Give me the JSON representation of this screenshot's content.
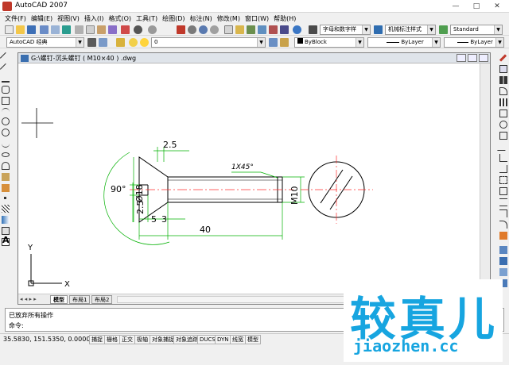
{
  "window": {
    "title": "AutoCAD 2007",
    "controls": [
      "—",
      "□",
      "✕"
    ]
  },
  "menu": [
    "文件(F)",
    "编辑(E)",
    "视图(V)",
    "插入(I)",
    "格式(O)",
    "工具(T)",
    "绘图(D)",
    "标注(N)",
    "修改(M)",
    "窗口(W)",
    "帮助(H)"
  ],
  "toolbar": {
    "text_style": "字母和数字样",
    "dim_style": "机械标注样式",
    "table_style": "Standard"
  },
  "properties": {
    "workspace": "AutoCAD 经典",
    "layer": "0",
    "color": "ByBlock",
    "linetype": "ByLayer",
    "lineweight": "ByLayer"
  },
  "document": {
    "title": "G:\\螺钉-沉头螺钉 ( M10×40 ) .dwg",
    "tabs": [
      "模型",
      "布局1",
      "布局2"
    ]
  },
  "drawing": {
    "dims": {
      "top": "2.5",
      "chamfer": "1X45°",
      "angle": "90°",
      "diameter": "Ø18",
      "slot": "2.5",
      "head_a": "5",
      "head_b": "3",
      "length": "40",
      "thread": "M10"
    },
    "ucs_x": "X",
    "ucs_y": "Y"
  },
  "command": {
    "history": "已放弃所有操作",
    "prompt": "命令:"
  },
  "status": {
    "coords": "35.5830,  151.5350,  0.0000",
    "buttons": [
      "捕捉",
      "栅格",
      "正交",
      "极轴",
      "对象捕捉",
      "对象追踪",
      "DUCS",
      "DYN",
      "线宽",
      "模型"
    ]
  },
  "watermark": {
    "text": "较真儿",
    "url": "jiaozhen.cc"
  },
  "colors": {
    "dimension": "#00b000",
    "center": "#ff3030",
    "outline": "#000000",
    "accent": "#17a5e0"
  }
}
